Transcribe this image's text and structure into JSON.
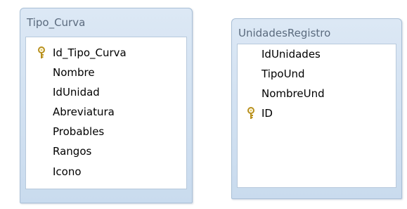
{
  "tables": [
    {
      "title": "Tipo_Curva",
      "fields": [
        {
          "name": "Id_Tipo_Curva",
          "key": true
        },
        {
          "name": "Nombre",
          "key": false
        },
        {
          "name": "IdUnidad",
          "key": false
        },
        {
          "name": "Abreviatura",
          "key": false
        },
        {
          "name": "Probables",
          "key": false
        },
        {
          "name": "Rangos",
          "key": false
        },
        {
          "name": "Icono",
          "key": false
        }
      ]
    },
    {
      "title": "UnidadesRegistro",
      "fields": [
        {
          "name": "IdUnidades",
          "key": false
        },
        {
          "name": "TipoUnd",
          "key": false
        },
        {
          "name": "NombreUnd",
          "key": false
        },
        {
          "name": "ID",
          "key": true
        }
      ]
    }
  ],
  "icons": {
    "primary_key": "key-icon"
  },
  "colors": {
    "window_border": "#a9bfd6",
    "title_text": "#5b6b7e",
    "key_gold": "#c9a227"
  }
}
